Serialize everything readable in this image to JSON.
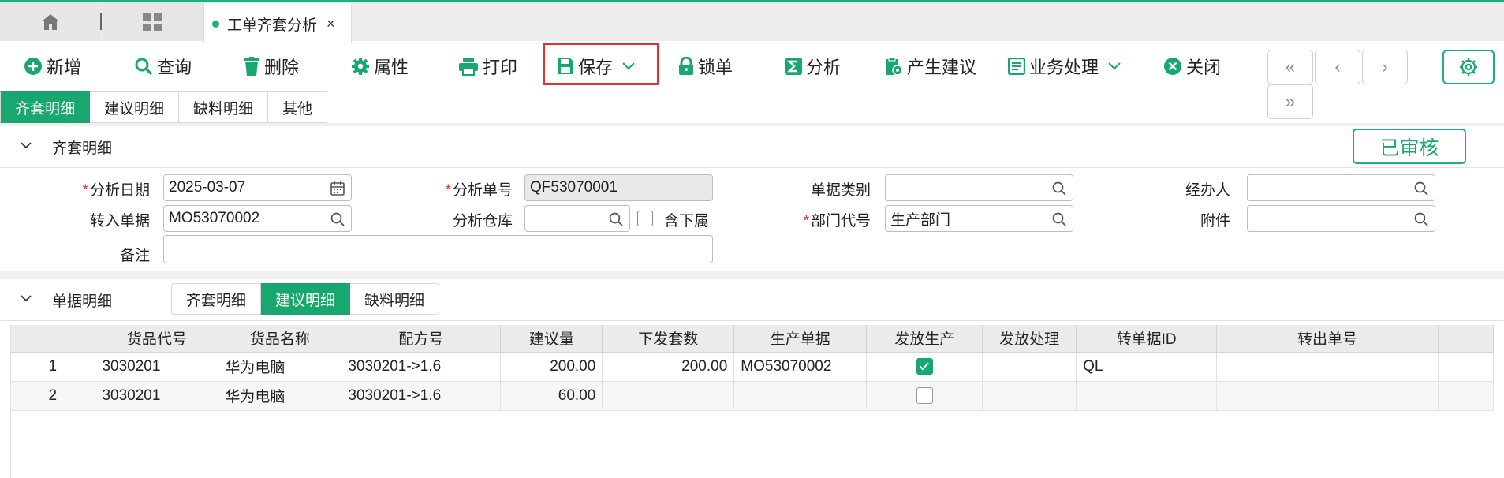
{
  "tabs": {
    "home_icon": "home-icon",
    "grid_icon": "apps-grid-icon",
    "active_tab_label": "工单齐套分析",
    "close_glyph": "×"
  },
  "toolbar": {
    "add": "新增",
    "query": "查询",
    "delete": "删除",
    "properties": "属性",
    "print": "打印",
    "save": "保存",
    "lock": "锁单",
    "analyze": "分析",
    "generate": "产生建议",
    "business": "业务处理",
    "close": "关闭",
    "nav_first": "«",
    "nav_prev": "‹",
    "nav_next": "›",
    "nav_last": "»"
  },
  "subtabs": [
    "齐套明细",
    "建议明细",
    "缺料明细",
    "其他"
  ],
  "header_section": {
    "title": "齐套明细",
    "status": "已审核"
  },
  "form": {
    "analysis_date_label": "分析日期",
    "analysis_date_value": "2025-03-07",
    "analysis_no_label": "分析单号",
    "analysis_no_value": "QF53070001",
    "doc_type_label": "单据类别",
    "doc_type_value": "",
    "handler_label": "经办人",
    "handler_value": "",
    "source_doc_label": "转入单据",
    "source_doc_value": "MO53070002",
    "warehouse_label": "分析仓库",
    "warehouse_value": "",
    "include_sub_label": "含下属",
    "dept_label": "部门代号",
    "dept_value": "生产部门",
    "attachment_label": "附件",
    "attachment_value": "",
    "remark_label": "备注",
    "remark_value": "",
    "required_mark": "*"
  },
  "detail_section": {
    "title": "单据明细",
    "tabs": [
      "齐套明细",
      "建议明细",
      "缺料明细"
    ]
  },
  "table": {
    "columns": [
      "",
      "货品代号",
      "货品名称",
      "配方号",
      "建议量",
      "下发套数",
      "生产单据",
      "发放生产",
      "发放处理",
      "转单据ID",
      "转出单号",
      ""
    ],
    "rows": [
      {
        "idx": "1",
        "code": "3030201",
        "name": "华为电脑",
        "formula": "3030201->1.6",
        "qty": "200.00",
        "sets": "200.00",
        "prod_doc": "MO53070002",
        "issued": true,
        "handling": "",
        "trans_id": "QL",
        "out_no": ""
      },
      {
        "idx": "2",
        "code": "3030201",
        "name": "华为电脑",
        "formula": "3030201->1.6",
        "qty": "60.00",
        "sets": "",
        "prod_doc": "",
        "issued": false,
        "handling": "",
        "trans_id": "",
        "out_no": ""
      }
    ]
  },
  "colors": {
    "accent": "#18a86f",
    "highlight": "#e5302e"
  }
}
